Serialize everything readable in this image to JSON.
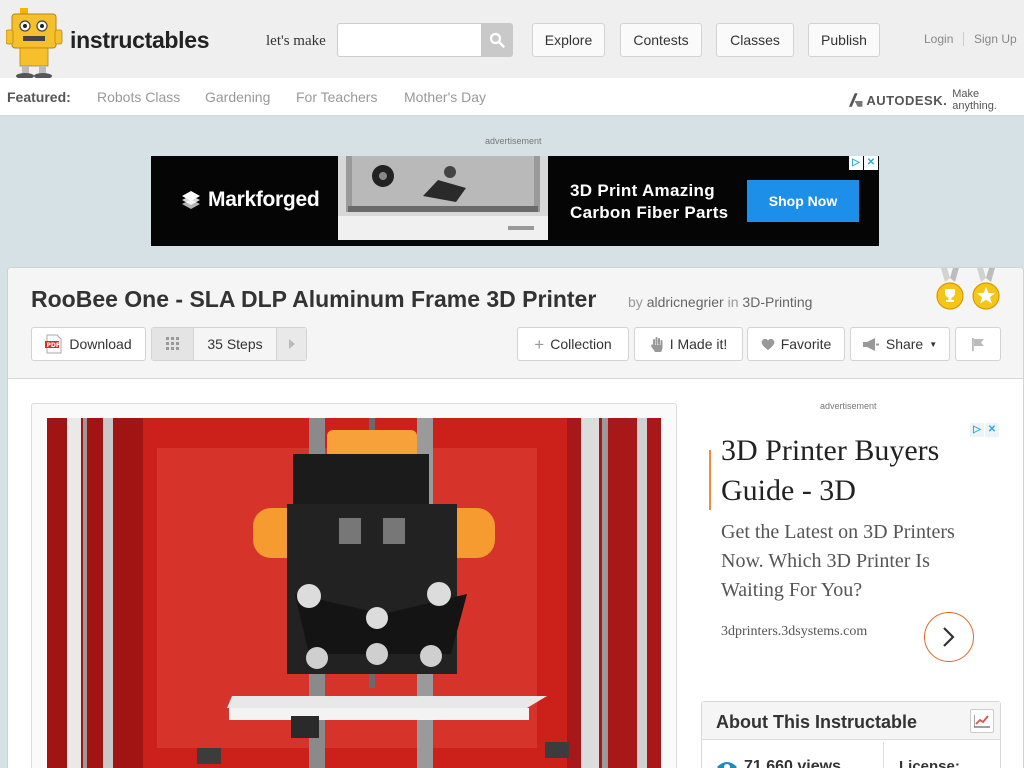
{
  "header": {
    "logo_text": "instructables",
    "lets_make": "let's make",
    "search_placeholder": "",
    "search_icon": "search-icon",
    "nav": [
      "Explore",
      "Contests",
      "Classes",
      "Publish"
    ],
    "login": "Login",
    "signup": "Sign Up"
  },
  "featured": {
    "label": "Featured:",
    "links": [
      "Robots Class",
      "Gardening",
      "For Teachers",
      "Mother's Day"
    ],
    "sponsor_name": "AUTODESK.",
    "sponsor_tagline": "Make anything."
  },
  "top_ad": {
    "label": "advertisement",
    "brand": "Markforged",
    "headline_line1": "3D Print Amazing",
    "headline_line2": "Carbon Fiber Parts",
    "cta": "Shop Now"
  },
  "instructable": {
    "title": "RooBee One - SLA DLP Aluminum Frame 3D Printer",
    "by": "by",
    "author": "aldricnegrier",
    "in": "in",
    "category": "3D-Printing",
    "medals": [
      "trophy-medal-icon",
      "star-medal-icon"
    ]
  },
  "actions": {
    "download": "Download",
    "pdf_badge": "PDF",
    "steps": "35 Steps",
    "collection": "Collection",
    "made_it": "I Made it!",
    "favorite": "Favorite",
    "share": "Share"
  },
  "side_ad": {
    "label": "advertisement",
    "headline": "3D Printer Buyers Guide - 3D",
    "body": "Get the Latest on 3D Printers Now. Which 3D Printer Is Waiting For You?",
    "url": "3dprinters.3dsystems.com"
  },
  "about": {
    "title": "About This Instructable",
    "views": "71,660 views",
    "license_label": "License:"
  },
  "colors": {
    "shop_now": "#1e8fe8",
    "ad_accent": "#f28c3c",
    "image_red": "#c01a1a"
  }
}
